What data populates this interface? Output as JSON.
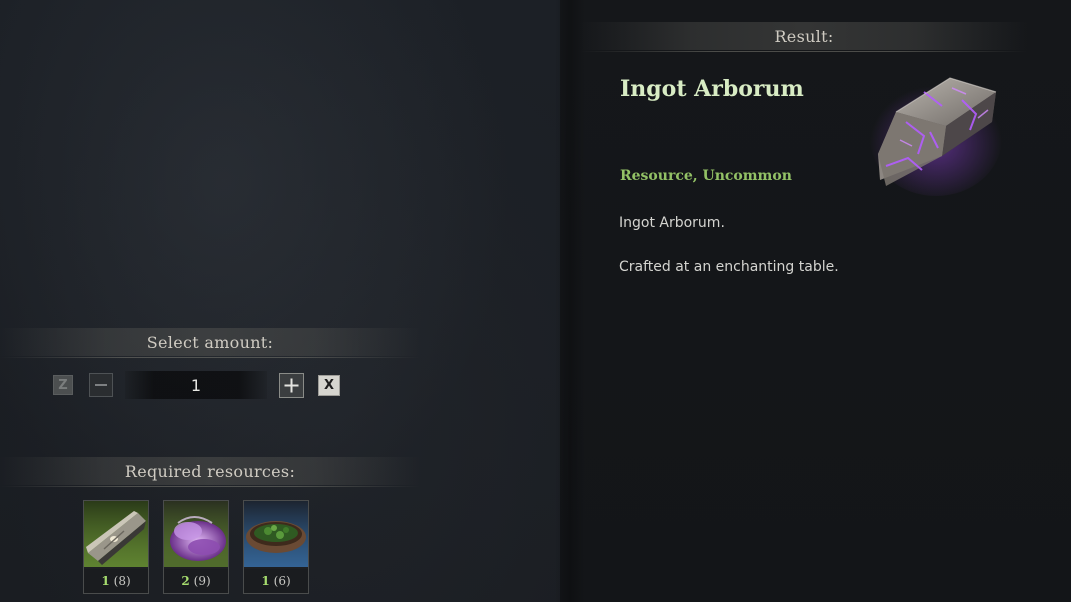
{
  "result": {
    "header": "Result:",
    "item_name": "Ingot Arborum",
    "category": "Resource, Uncommon",
    "description": [
      "Ingot Arborum.",
      "Crafted at an enchanting table."
    ]
  },
  "amount": {
    "header": "Select amount:",
    "decrease_key": "Z",
    "increase_key": "X",
    "value": "1"
  },
  "resources": {
    "header": "Required resources:",
    "items": [
      {
        "icon": "wood-log-icon",
        "need": "1",
        "have": "(8)",
        "rarity_color": "#7aa83c"
      },
      {
        "icon": "purple-essence-icon",
        "need": "2",
        "have": "(9)",
        "rarity_color": "#7aa83c"
      },
      {
        "icon": "herb-bowl-icon",
        "need": "1",
        "have": "(6)",
        "rarity_color": "#3d7ab8"
      }
    ]
  },
  "colors": {
    "item_name": "#d8ecc4",
    "category": "#93c266",
    "count_need": "#a6dc6e"
  }
}
